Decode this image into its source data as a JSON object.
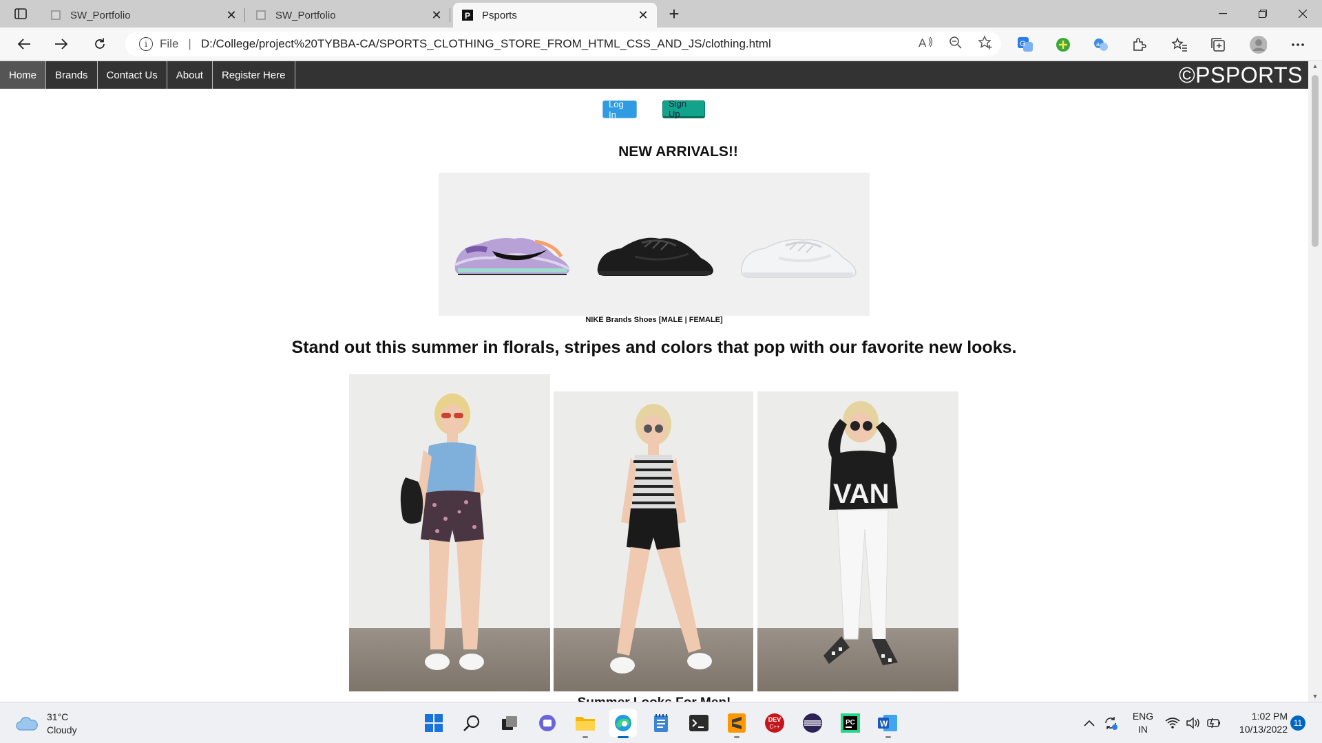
{
  "browser": {
    "tabs": [
      {
        "title": "SW_Portfolio",
        "active": false
      },
      {
        "title": "SW_Portfolio",
        "active": false
      },
      {
        "title": "Psports",
        "active": true
      }
    ],
    "address": {
      "scheme": "File",
      "url": "D:/College/project%20TYBBA-CA/SPORTS_CLOTHING_STORE_FROM_HTML_CSS_AND_JS/clothing.html"
    }
  },
  "site": {
    "nav": [
      "Home",
      "Brands",
      "Contact Us",
      "About",
      "Register Here"
    ],
    "active_nav": "Home",
    "brand": "©PSPORTS",
    "login_label": "Log In",
    "signup_label": "Sign Up",
    "arrivals_heading": "NEW ARRIVALS!!",
    "shoes_caption": "NIKE Brands Shoes [MALE | FEMALE]",
    "summer_heading": "Stand out this summer in florals, stripes and colors that pop with our favorite new looks.",
    "men_heading": "Summer Looks For Men!",
    "photo_text": "VAN"
  },
  "taskbar": {
    "weather": {
      "temp": "31°C",
      "condition": "Cloudy"
    },
    "lang": {
      "line1": "ENG",
      "line2": "IN"
    },
    "clock": {
      "time": "1:02 PM",
      "date": "10/13/2022"
    },
    "notifications": "11",
    "dev_label": "DEV C++",
    "pycharm_label": "PC",
    "word_label": "W"
  },
  "colors": {
    "nav_bg": "#333333",
    "login_bg": "#2e9be3",
    "signup_bg": "#13a38a",
    "accent": "#0067c0"
  }
}
